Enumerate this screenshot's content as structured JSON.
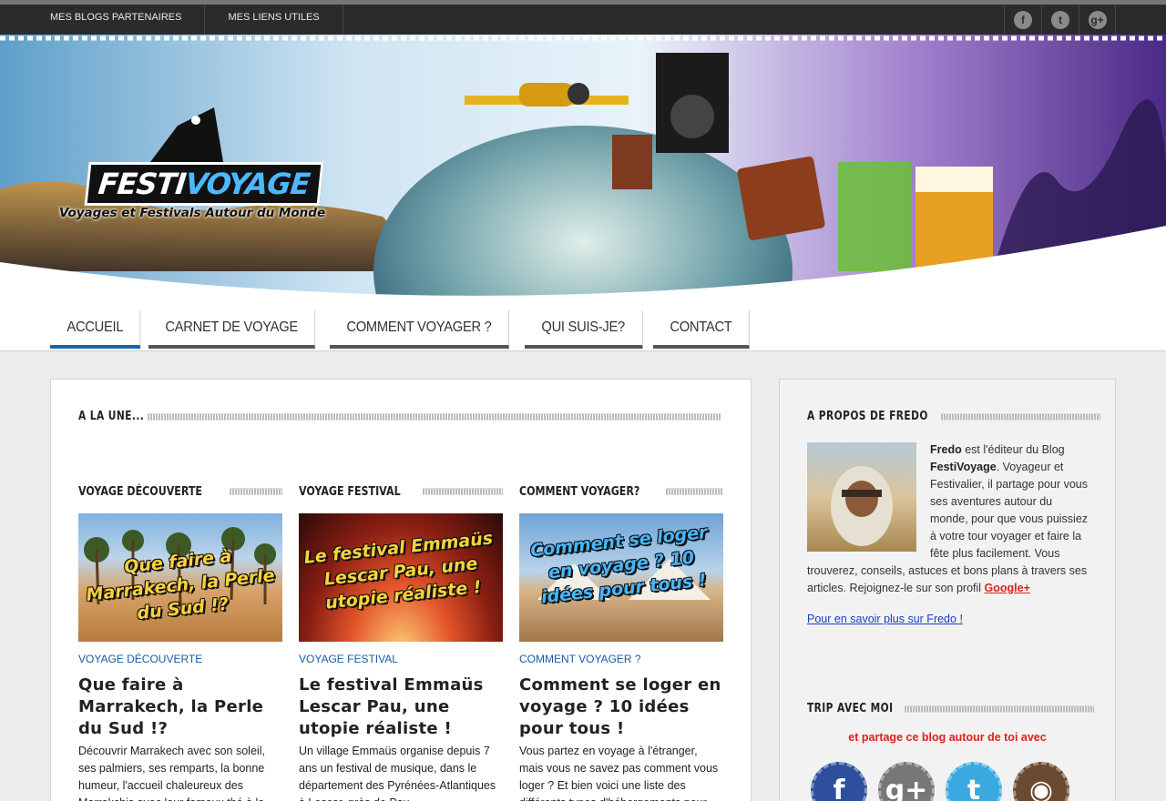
{
  "topbar": {
    "links": [
      "MES BLOGS PARTENAIRES",
      "MES LIENS UTILES"
    ],
    "social": [
      {
        "icon": "facebook-icon",
        "glyph": "f"
      },
      {
        "icon": "twitter-icon",
        "glyph": "t"
      },
      {
        "icon": "google-plus-icon",
        "glyph": "g+"
      }
    ]
  },
  "banner": {
    "logo_main_a": "FESTI",
    "logo_main_b": "VOYAGE",
    "logo_tagline": "Voyages et Festivals Autour du Monde"
  },
  "nav": {
    "items": [
      "ACCUEIL",
      "CARNET DE VOYAGE",
      "COMMENT VOYAGER ?",
      "QUI SUIS-JE?",
      "CONTACT"
    ],
    "active_index": 0,
    "accent_color": "#1a65a3"
  },
  "main": {
    "section_title": "A LA UNE...",
    "columns": [
      {
        "category_title": "VOYAGE DÉCOUVERTE",
        "thumb_caption": "Que faire à Marrakech, la Perle du Sud !?",
        "category_link": "VOYAGE DÉCOUVERTE",
        "post_title": "Que faire à Marrakech, la Perle du Sud !?",
        "excerpt": "Découvrir Marrakech avec son soleil, ses palmiers, ses remparts, la bonne humeur, l'accueil chaleureux des Marrakchis avec leur fameux thé à la menthe. C'est un lieu à visiter sans"
      },
      {
        "category_title": "VOYAGE FESTIVAL",
        "thumb_caption": "Le festival Emmaüs Lescar Pau, une utopie réaliste !",
        "category_link": "VOYAGE FESTIVAL",
        "post_title": "Le festival Emmaüs Lescar Pau, une utopie réaliste !",
        "excerpt": "Un village Emmaüs organise depuis 7 ans un festival de musique, dans le département des Pyrénées-Atlantiques à Lescar, près de Pau"
      },
      {
        "category_title": "COMMENT VOYAGER?",
        "thumb_caption": "Comment se loger en voyage ? 10 idées pour tous !",
        "category_link": "COMMENT VOYAGER ?",
        "post_title": "Comment se loger en voyage ? 10 idées pour tous !",
        "excerpt": "Vous partez en voyage à l'étranger, mais vous ne savez pas comment vous loger ? Et bien voici une liste des différents types d'hébergements pour"
      }
    ]
  },
  "sidebar": {
    "about_title": "A PROPOS DE FREDO",
    "about_name": "Fredo",
    "about_text_1": " est l'éditeur du Blog ",
    "about_blog": "FestiVoyage",
    "about_text_2": ". Voyageur et Festivalier, il partage pour vous ses aventures autour du monde, pour que vous puissiez à votre tour voyager et faire la fête plus facilement. Vous trouverez, conseils, astuces et bons plans à travers ses articles. Rejoignez-le sur son profil ",
    "about_gplus": "Google+",
    "about_more": "Pour en savoir plus sur Fredo !",
    "trip_title": "TRIP AVEC MOI",
    "trip_sub": "et partage ce blog autour de toi avec",
    "big_social": [
      {
        "icon": "facebook-icon",
        "glyph": "f",
        "color": "#2d4f9e"
      },
      {
        "icon": "google-plus-icon",
        "glyph": "g+",
        "color": "#777777"
      },
      {
        "icon": "twitter-icon",
        "glyph": "t",
        "color": "#3aa9e0"
      },
      {
        "icon": "instagram-icon",
        "glyph": "◉",
        "color": "#6b4a32"
      }
    ]
  }
}
